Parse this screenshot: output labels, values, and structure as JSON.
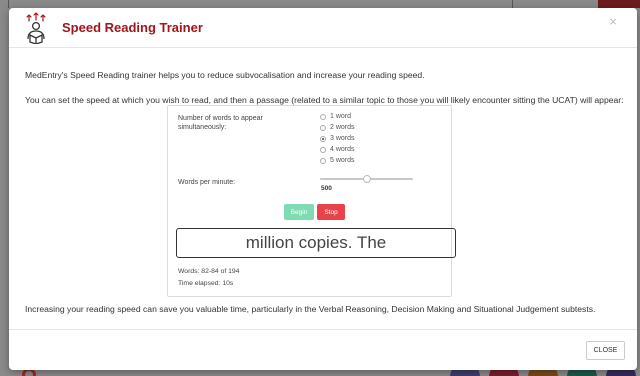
{
  "modal": {
    "title": "Speed Reading Trainer",
    "close_icon": "×",
    "intro_1": "MedEntry's Speed Reading trainer helps you to reduce subvocalisation and increase your reading speed.",
    "intro_2": "You can set the speed at which you wish to read, and then a passage (related to a similar topic to those you will likely encounter sitting the UCAT) will appear:",
    "outro": "Increasing your reading speed can save you valuable time, particularly in the Verbal Reasoning, Decision Making and Situational Judgement subtests.",
    "close_button": "CLOSE"
  },
  "trainer": {
    "words_label": "Number of words to appear simultaneously:",
    "options": [
      {
        "label": "1 word",
        "checked": false
      },
      {
        "label": "2 words",
        "checked": false
      },
      {
        "label": "3 words",
        "checked": true
      },
      {
        "label": "4 words",
        "checked": false
      },
      {
        "label": "5 words",
        "checked": false
      }
    ],
    "wpm_label": "Words per minute:",
    "wpm_value": "500",
    "wpm_fraction": 0.5,
    "begin_label": "Begin",
    "stop_label": "Stop",
    "current_words": "million copies. The",
    "words_progress": "Words: 82-84 of 194",
    "time_elapsed": "Time elapsed: 10s"
  },
  "colors": {
    "title": "#a3141b",
    "begin": "#7fdcb2",
    "stop": "#e8424b"
  },
  "icons": {
    "logo": "speed-reading-person-book-icon"
  }
}
